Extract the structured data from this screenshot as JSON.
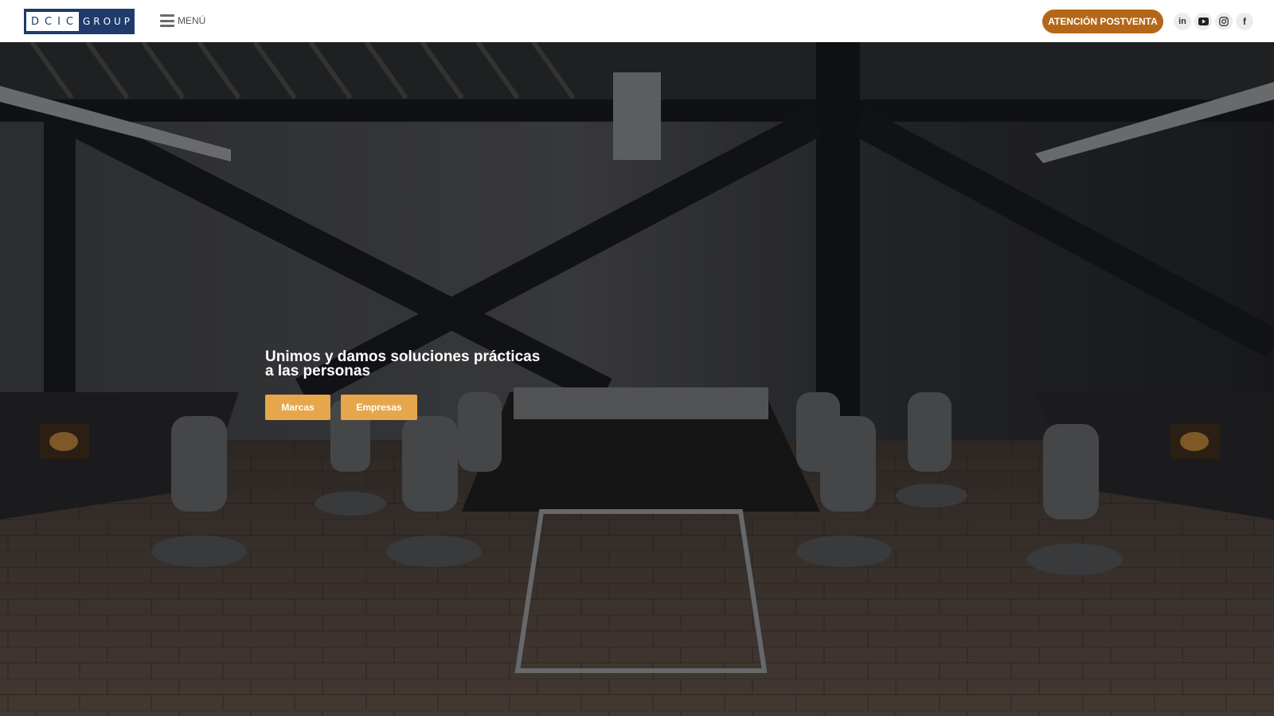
{
  "header": {
    "logo": {
      "left": "DCIC",
      "right": "GROUP"
    },
    "menu_label": "MENÚ",
    "cta_label": "ATENCIÓN POSTVENTA",
    "social": [
      {
        "name": "linkedin",
        "icon": "linkedin-icon",
        "glyph": "in"
      },
      {
        "name": "youtube",
        "icon": "youtube-icon"
      },
      {
        "name": "instagram",
        "icon": "instagram-icon"
      },
      {
        "name": "facebook",
        "icon": "facebook-icon",
        "glyph": "f"
      }
    ]
  },
  "hero": {
    "headline_line1": "Unimos y damos soluciones prácticas",
    "headline_line2": "a las personas",
    "buttons": {
      "marcas": "Marcas",
      "empresas": "Empresas"
    }
  },
  "colors": {
    "brand_navy": "#1f3a6b",
    "cta": "#b46718",
    "hero_button": "#e6a64b"
  }
}
